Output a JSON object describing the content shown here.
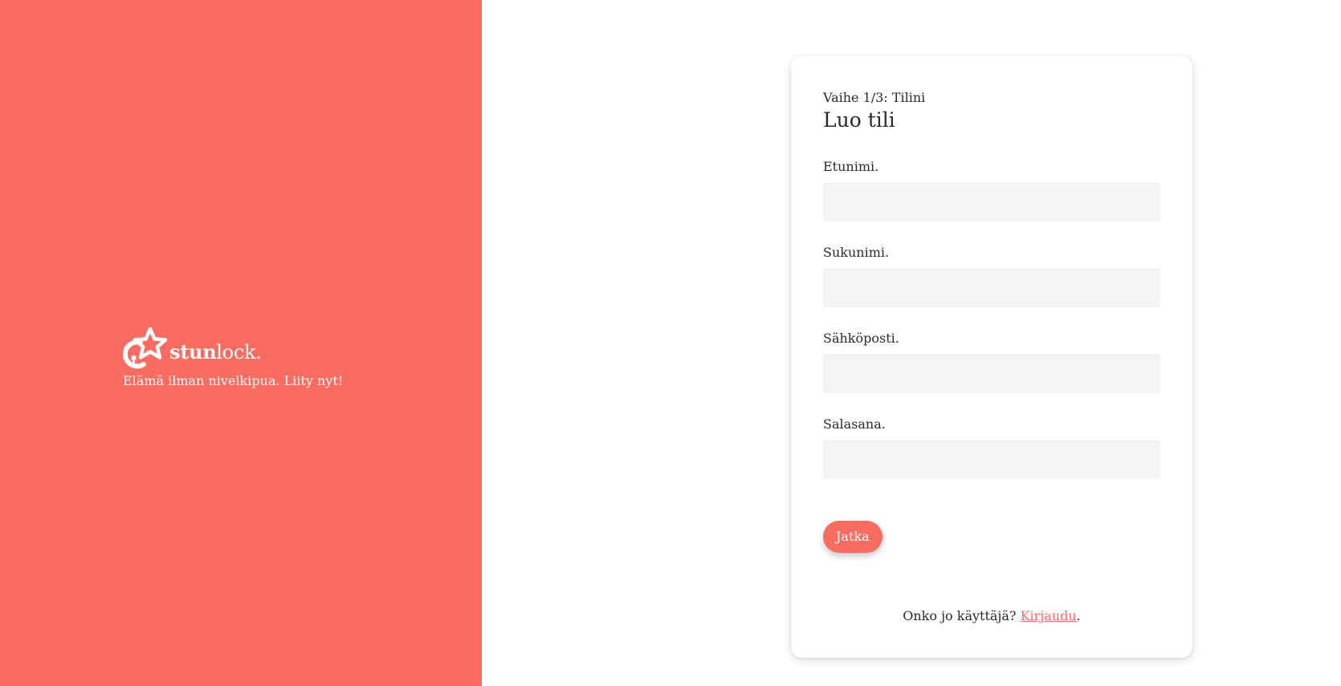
{
  "colors": {
    "brand": "#f96c5f",
    "input_bg": "#f3f4f6",
    "text": "#2b2b2b"
  },
  "brand": {
    "logo_icon": "star-key-logo-icon",
    "wordmark_bold": "stun",
    "wordmark_regular": "lock.",
    "tagline": "Elämä ilman nivelkipua. Liity nyt!"
  },
  "form": {
    "step": "Vaihe 1/3: Tilini",
    "title": "Luo tili",
    "fields": [
      {
        "label": "Etunimi.",
        "value": "",
        "placeholder": ""
      },
      {
        "label": "Sukunimi.",
        "value": "",
        "placeholder": ""
      },
      {
        "label": "Sähköposti.",
        "value": "",
        "placeholder": ""
      },
      {
        "label": "Salasana.",
        "value": "",
        "placeholder": ""
      }
    ],
    "submit_label": "Jatka",
    "footer_text": "Onko jo käyttäjä?",
    "login_link": "Kirjaudu",
    "footer_end": "."
  }
}
